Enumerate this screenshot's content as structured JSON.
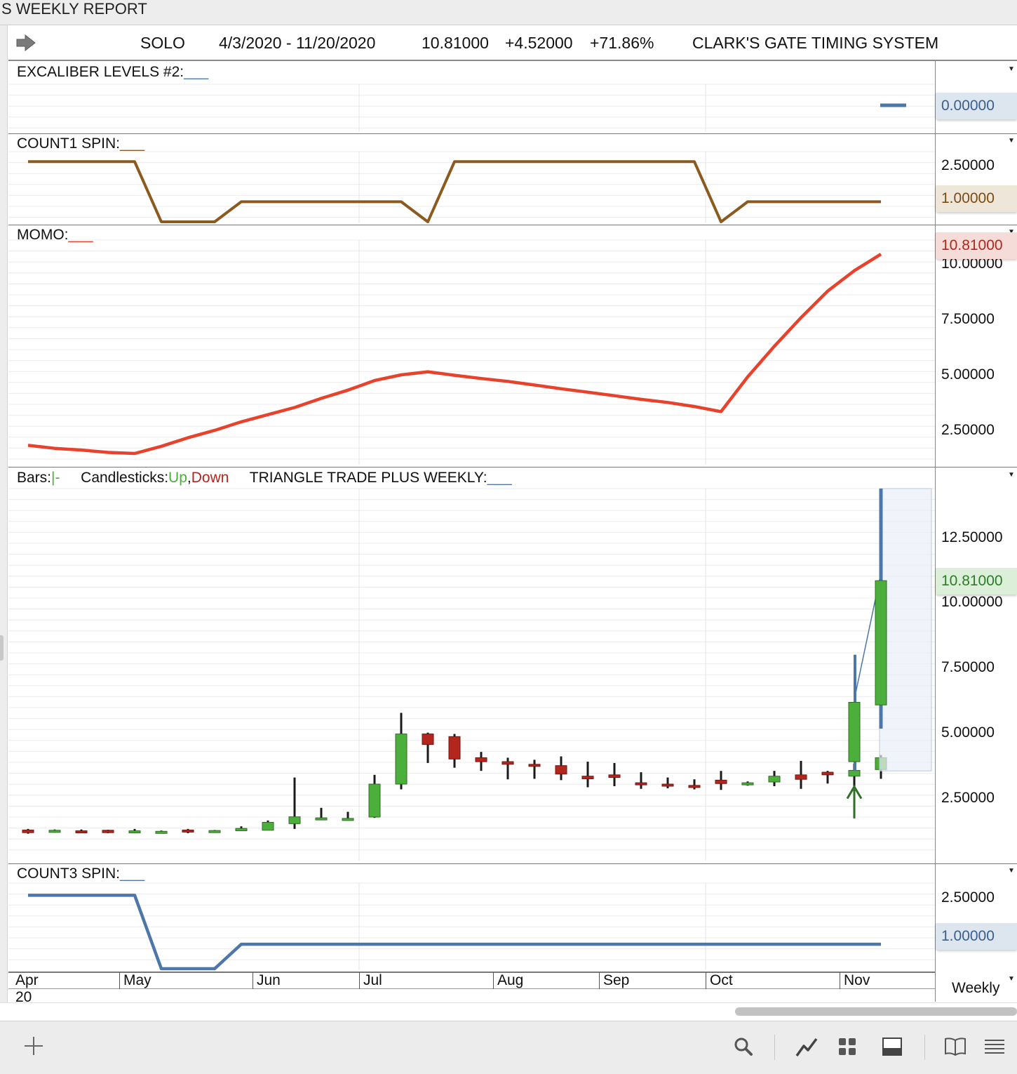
{
  "window": {
    "title": "S WEEKLY REPORT"
  },
  "header": {
    "symbol": "SOLO",
    "date_range": "4/3/2020 - 11/20/2020",
    "last": "10.81000",
    "change": "+4.52000",
    "change_pct": "+71.86%",
    "system": "CLARK'S GATE TIMING SYSTEM"
  },
  "panels": {
    "excaliber": {
      "label": "EXCALIBER LEVELS #2:",
      "legend": "___",
      "value_tag": "0.00000"
    },
    "count1": {
      "label": "COUNT1 SPIN:",
      "legend": "___",
      "ticks": [
        "2.50000"
      ],
      "value_tag": "1.00000"
    },
    "momo": {
      "label": "MOMO:",
      "legend": "___",
      "ticks": [
        "10.00000",
        "7.50000",
        "5.00000",
        "2.50000"
      ],
      "value_tag": "10.81000"
    },
    "price": {
      "bars_label": "Bars:",
      "bars_symbol": "|-",
      "candles_label": "Candlesticks:",
      "up_label": "Up",
      "sep": ",",
      "down_label": "Down",
      "triangle_label": "TRIANGLE TRADE PLUS WEEKLY:",
      "legend": "___",
      "ticks": [
        "12.50000",
        "10.00000",
        "7.50000",
        "5.00000",
        "2.50000"
      ],
      "value_tag": "10.81000"
    },
    "count3": {
      "label": "COUNT3 SPIN:",
      "legend": "___",
      "ticks": [
        "2.50000"
      ],
      "value_tag": "1.00000"
    }
  },
  "x_axis": {
    "months": [
      "Apr",
      "May",
      "Jun",
      "Jul",
      "Aug",
      "Sep",
      "Oct",
      "Nov"
    ],
    "year": "20",
    "period": "Weekly"
  },
  "colors": {
    "up": "#4caf3c",
    "down": "#b3261e",
    "momo": "#e8412c",
    "count1": "#8a5a1f",
    "count3": "#4d77a8",
    "grid": "#ececec"
  },
  "toolbar": {
    "icons": [
      "plus-icon",
      "search-icon",
      "draw-line-icon",
      "grid-layout-icon",
      "panel-layout-icon",
      "book-icon",
      "menu-icon"
    ]
  },
  "chart_data": [
    {
      "type": "line",
      "weeks": 33,
      "series": [
        {
          "values": [
            3,
            3,
            3,
            3,
            3,
            0,
            0,
            0,
            1,
            1,
            1,
            1,
            1,
            1,
            1,
            0,
            3,
            3,
            3,
            3,
            3,
            3,
            3,
            3,
            3,
            3,
            0,
            1,
            1,
            1,
            1,
            1,
            1
          ]
        }
      ],
      "ylim": [
        0,
        3.5
      ]
    },
    {
      "type": "line",
      "weeks": 33,
      "series": [
        {
          "values": [
            1.45,
            1.3,
            1.22,
            1.1,
            1.05,
            1.4,
            1.82,
            2.18,
            2.6,
            2.95,
            3.3,
            3.75,
            4.15,
            4.62,
            4.9,
            5.05,
            4.88,
            4.72,
            4.58,
            4.4,
            4.22,
            4.05,
            3.88,
            3.7,
            3.55,
            3.35,
            3.1,
            4.8,
            6.3,
            7.7,
            9.0,
            10.0,
            10.81
          ]
        }
      ],
      "ylim": [
        0.5,
        11.5
      ]
    },
    {
      "type": "candlestick",
      "weeks": 33,
      "series": [
        {
          "open": [
            1.36,
            1.3,
            1.33,
            1.35,
            1.3,
            1.29,
            1.36,
            1.32,
            1.33,
            1.35,
            1.6,
            1.82,
            1.78,
            1.85,
            3.1,
            5.0,
            4.9,
            4.1,
            3.95,
            3.85,
            3.8,
            3.4,
            3.45,
            3.15,
            3.1,
            3.05,
            3.25,
            3.08,
            3.18,
            3.45,
            3.55,
            3.4,
            3.65
          ],
          "close": [
            1.26,
            1.35,
            1.3,
            1.26,
            1.33,
            1.31,
            1.32,
            1.34,
            1.42,
            1.65,
            1.86,
            1.82,
            1.8,
            3.1,
            5.0,
            4.6,
            4.05,
            3.95,
            3.85,
            3.8,
            3.48,
            3.3,
            3.35,
            3.1,
            3.05,
            2.98,
            3.12,
            3.15,
            3.4,
            3.28,
            3.45,
            3.62,
            4.1
          ],
          "high": [
            1.4,
            1.38,
            1.38,
            1.37,
            1.4,
            1.34,
            1.4,
            1.36,
            1.5,
            1.72,
            3.35,
            2.2,
            2.05,
            3.45,
            5.8,
            5.05,
            5.0,
            4.32,
            4.1,
            4.02,
            4.15,
            3.95,
            3.9,
            3.55,
            3.35,
            3.28,
            3.6,
            3.2,
            3.6,
            3.98,
            3.6,
            3.88,
            4.2
          ],
          "low": [
            1.22,
            1.26,
            1.25,
            1.24,
            1.26,
            1.24,
            1.24,
            1.28,
            1.34,
            1.62,
            1.4,
            1.78,
            1.74,
            1.82,
            2.9,
            3.9,
            3.72,
            3.6,
            3.28,
            3.3,
            3.25,
            2.98,
            3.02,
            2.92,
            2.94,
            2.9,
            2.88,
            3.04,
            3.02,
            2.92,
            3.12,
            3.02,
            3.3
          ]
        }
      ],
      "ylim": [
        0.2,
        14.3
      ]
    },
    {
      "type": "line",
      "weeks": 33,
      "series": [
        {
          "values": [
            3,
            3,
            3,
            3,
            3,
            0,
            0,
            0,
            1,
            1,
            1,
            1,
            1,
            1,
            1,
            1,
            1,
            1,
            1,
            1,
            1,
            1,
            1,
            1,
            1,
            1,
            1,
            1,
            1,
            1,
            1,
            1,
            1
          ]
        }
      ],
      "ylim": [
        0,
        3.5
      ]
    }
  ]
}
